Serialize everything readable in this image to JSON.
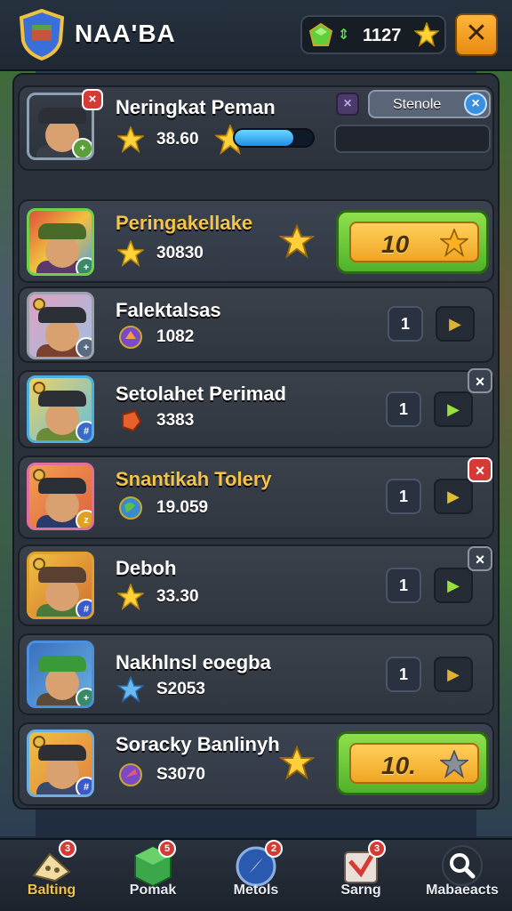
{
  "app": {
    "title": "NAA'BA"
  },
  "currency": {
    "value": "1127",
    "arrows": "⇕"
  },
  "header_row": {
    "name": "Neringkat Peman",
    "stat": "38.60",
    "progress": 0.75,
    "search_label": "Stenole",
    "close_x": "×"
  },
  "rows": [
    {
      "name": "Peringakellakе",
      "stat": "30830",
      "stat_icon": "star",
      "btn_value": "10",
      "badge": "+"
    },
    {
      "name": "Falektalsas",
      "stat": "1082",
      "stat_icon": "purple-gem",
      "num": "1",
      "badge": "+"
    },
    {
      "name": "Setolahet Perimad",
      "stat": "3383",
      "stat_icon": "red-gem",
      "num": "1",
      "badge": "#"
    },
    {
      "name": "Snantikah Tolery",
      "stat": "19.059",
      "stat_icon": "globe",
      "num": "1",
      "badge": "z"
    },
    {
      "name": "Deboh",
      "stat": "33.30",
      "stat_icon": "star",
      "num": "1",
      "badge": "#"
    },
    {
      "name": "Nakhlnsl eoegba",
      "stat": "S2053",
      "stat_icon": "blue-star",
      "num": "1",
      "badge": "+"
    },
    {
      "name": "Soracky Banlinyh",
      "stat": "S3070",
      "stat_icon": "purple-gem",
      "btn_value": "10.",
      "badge": "#"
    }
  ],
  "close_marks": {
    "red": "×",
    "dark": "×"
  },
  "close_label": "✕",
  "nav": [
    {
      "label": "Balting",
      "badge": "3"
    },
    {
      "label": "Pomak",
      "badge": "5"
    },
    {
      "label": "Metols",
      "badge": "2"
    },
    {
      "label": "Sarng",
      "badge": "3"
    },
    {
      "label": "Mabaeacts",
      "badge": ""
    }
  ],
  "colors": {
    "accent_gold": "#f4c44a",
    "button_green": "#4fb22a",
    "close_red": "#d63a34",
    "progress_blue": "#1f8ee6"
  }
}
